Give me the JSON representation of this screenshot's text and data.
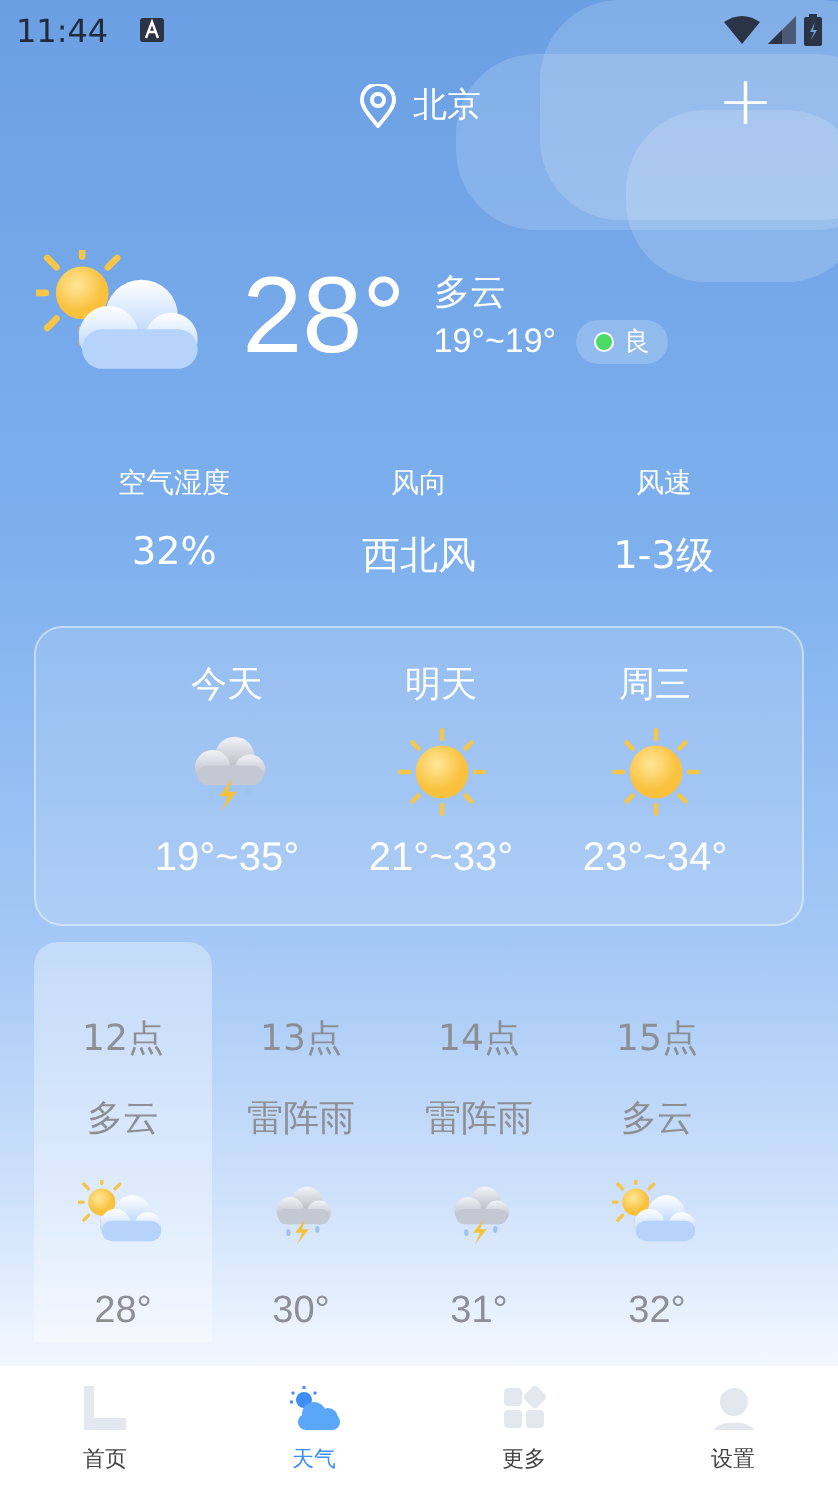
{
  "status_bar": {
    "time": "11:44"
  },
  "header": {
    "city": "北京",
    "add": "+"
  },
  "current": {
    "kind": "partly-cloudy",
    "temperature": "28°",
    "condition": "多云",
    "range": "19°~19°",
    "air_quality": {
      "label": "良",
      "color": "#4cd964"
    }
  },
  "stats": [
    {
      "label": "空气湿度",
      "value": "32%"
    },
    {
      "label": "风向",
      "value": "西北风"
    },
    {
      "label": "风速",
      "value": "1-3级"
    }
  ],
  "daily": [
    {
      "day": "今天",
      "kind": "thunder-rain",
      "range": "19°~35°"
    },
    {
      "day": "明天",
      "kind": "sunny",
      "range": "21°~33°"
    },
    {
      "day": "周三",
      "kind": "sunny",
      "range": "23°~34°"
    }
  ],
  "hourly": [
    {
      "hour": "12点",
      "condition": "多云",
      "kind": "partly-cloudy",
      "temp": "28°",
      "selected": true
    },
    {
      "hour": "13点",
      "condition": "雷阵雨",
      "kind": "thunder-rain",
      "temp": "30°",
      "selected": false
    },
    {
      "hour": "14点",
      "condition": "雷阵雨",
      "kind": "thunder-rain",
      "temp": "31°",
      "selected": false
    },
    {
      "hour": "15点",
      "condition": "多云",
      "kind": "partly-cloudy",
      "temp": "32°",
      "selected": false
    }
  ],
  "nav": [
    {
      "label": "首页",
      "kind": "home",
      "selected": false
    },
    {
      "label": "天气",
      "kind": "weather",
      "selected": true
    },
    {
      "label": "更多",
      "kind": "more",
      "selected": false
    },
    {
      "label": "设置",
      "kind": "settings",
      "selected": false
    }
  ]
}
